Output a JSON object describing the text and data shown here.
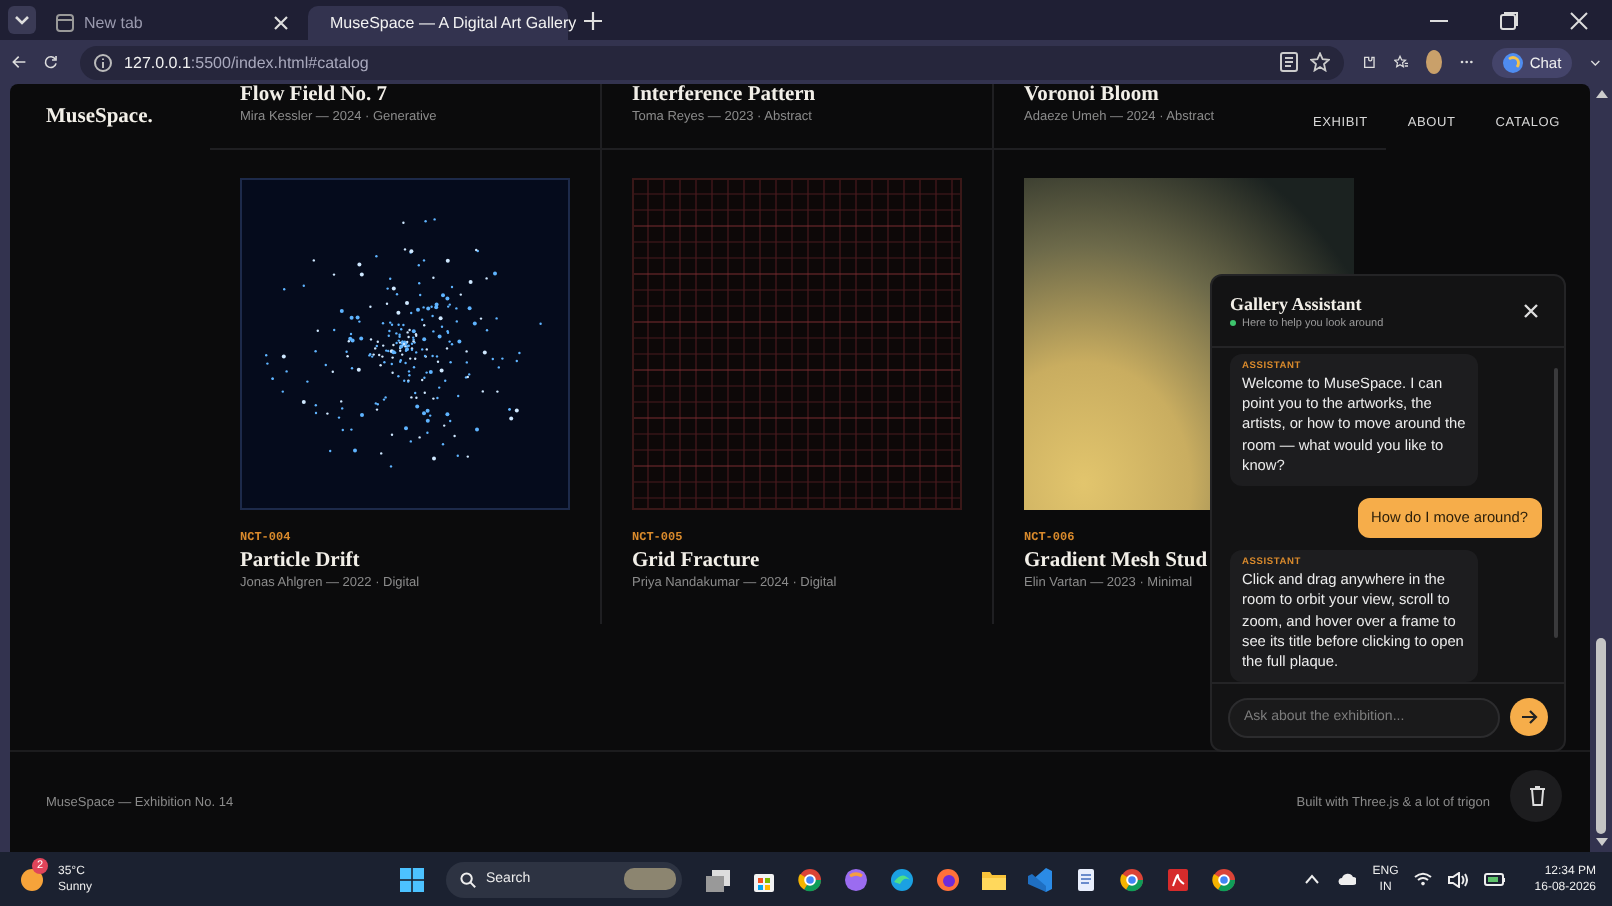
{
  "browser": {
    "tabs": [
      {
        "title": "New tab",
        "selected": false
      },
      {
        "title": "MuseSpace — A Digital Art Gallery",
        "selected": true
      }
    ],
    "url_host": "127.0.0.1",
    "url_rest": ":5500/index.html#catalog",
    "chat_button": "Chat"
  },
  "site": {
    "brand": "MuseSpace.",
    "nav": [
      {
        "label": "EXHIBIT"
      },
      {
        "label": "ABOUT"
      },
      {
        "label": "CATALOG"
      }
    ]
  },
  "gallery": {
    "top_row": [
      {
        "title": "Flow Field No. 7",
        "meta": "Mira Kessler — 2024 · Generative"
      },
      {
        "title": "Interference Pattern",
        "meta": "Toma Reyes — 2023 · Abstract"
      },
      {
        "title": "Voronoi Bloom",
        "meta": "Adaeze Umeh — 2024 · Abstract"
      }
    ],
    "artworks": [
      {
        "kind": "particles",
        "code": "NCT-004",
        "title": "Particle Drift",
        "meta": "Jonas Ahlgren — 2022 · Digital"
      },
      {
        "kind": "grid",
        "code": "NCT-005",
        "title": "Grid Fracture",
        "meta": "Priya Nandakumar — 2024 · Digital"
      },
      {
        "kind": "gradient",
        "code": "NCT-006",
        "title": "Gradient Mesh Stud",
        "meta": "Elin Vartan — 2023 · Minimal"
      }
    ]
  },
  "chat": {
    "title": "Gallery Assistant",
    "status": "Here to help you look around",
    "messages": [
      {
        "kind": "assistant",
        "label": "ASSISTANT",
        "text": "Welcome to MuseSpace. I can point you to the artworks, the artists, or how to move around the room — what would you like to know?"
      },
      {
        "kind": "user",
        "text": "How do I move around?"
      },
      {
        "kind": "assistant",
        "label": "ASSISTANT",
        "text": "Click and drag anywhere in the room to orbit your view, scroll to zoom, and hover over a frame to see its title before clicking to open the full plaque."
      }
    ],
    "placeholder": "Ask about the exhibition..."
  },
  "footer": {
    "left": "MuseSpace — Exhibition No. 14",
    "right": "Built with Three.js & a lot of trigon"
  },
  "taskbar": {
    "weather_badge": "2",
    "temperature": "35°C",
    "condition": "Sunny",
    "search_placeholder": "Search",
    "language": "ENG",
    "region": "IN",
    "time": "12:34 PM",
    "date": "16-08-2026"
  }
}
